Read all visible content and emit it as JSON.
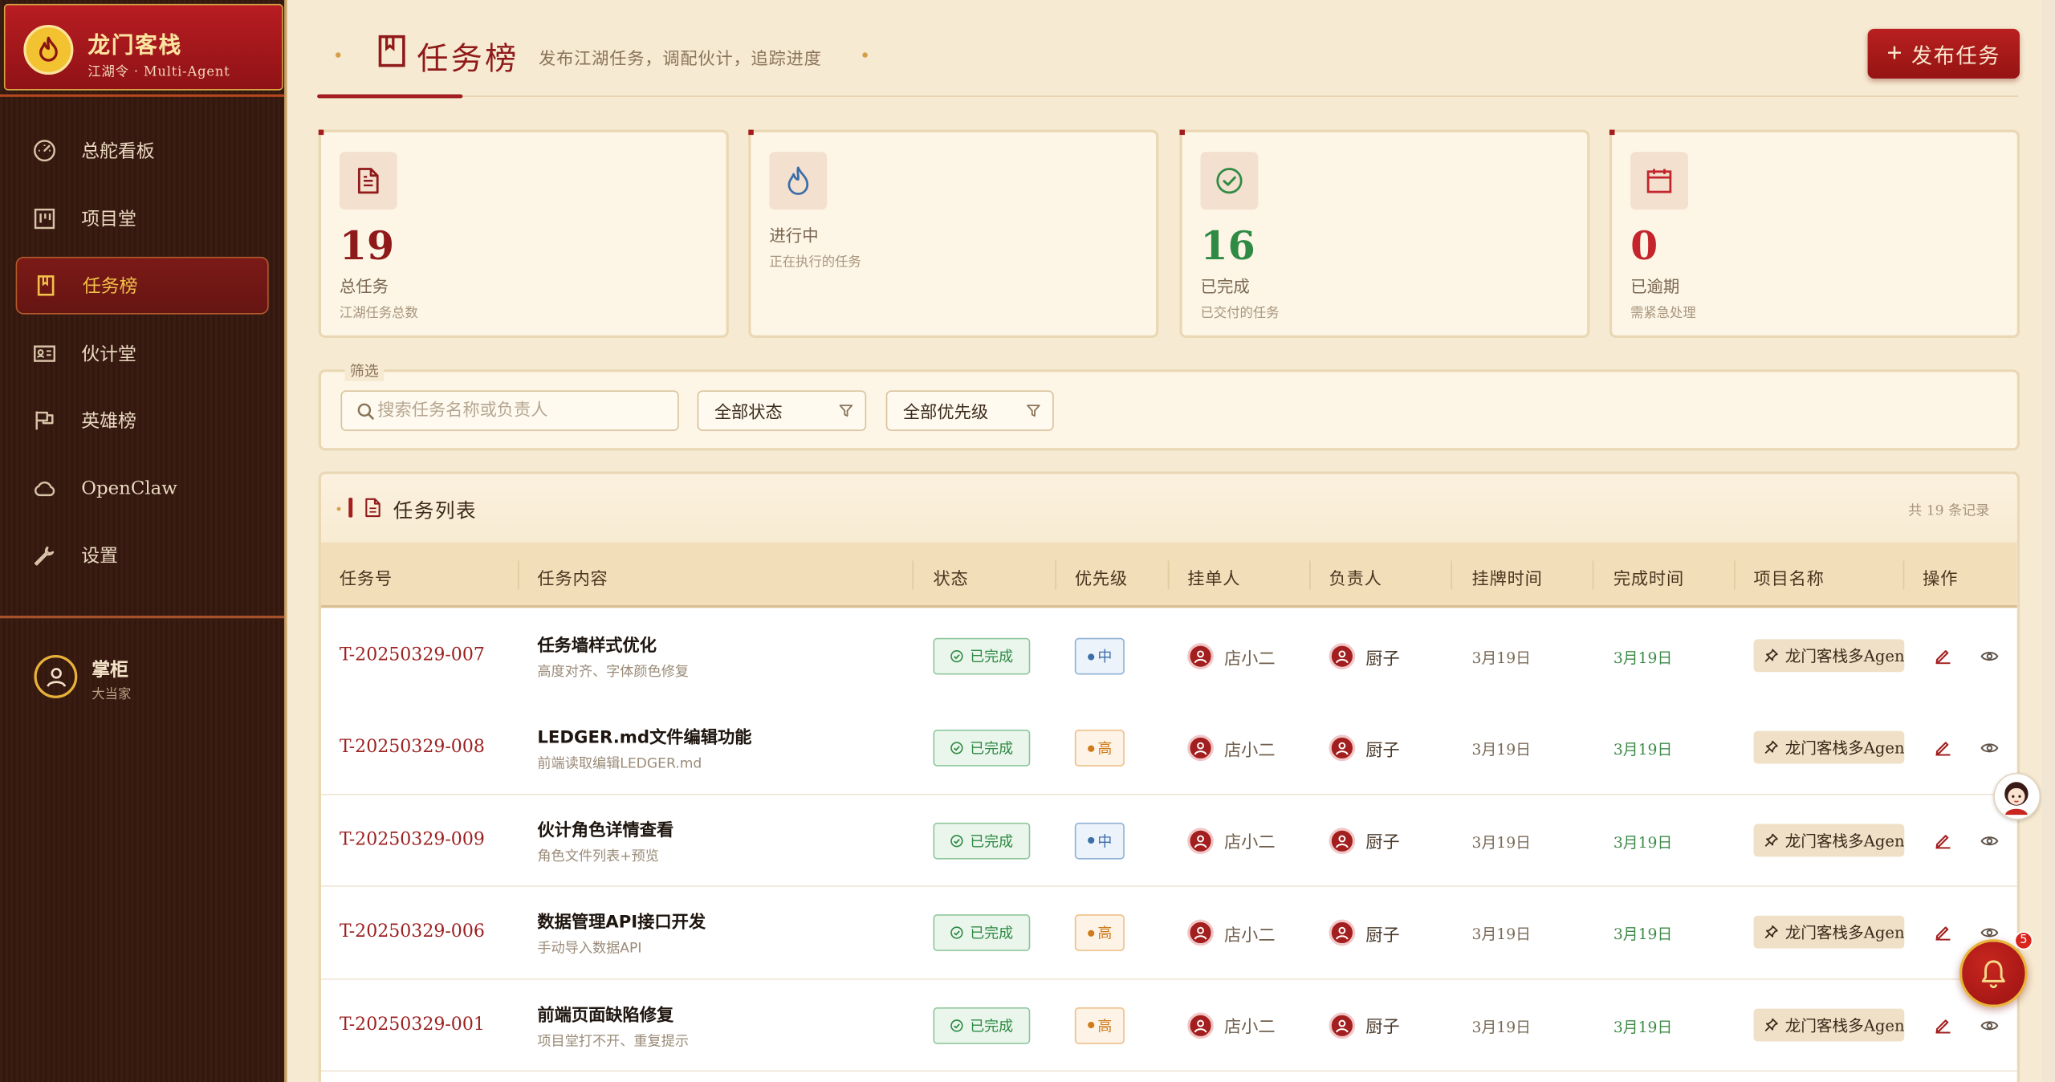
{
  "brand": {
    "title": "龙门客栈",
    "subtitle": "江湖令 · Multi-Agent"
  },
  "nav": [
    {
      "label": "总舵看板",
      "icon": "dashboard-icon",
      "active": false
    },
    {
      "label": "项目堂",
      "icon": "board-icon",
      "active": false
    },
    {
      "label": "任务榜",
      "icon": "bookmark-icon",
      "active": true
    },
    {
      "label": "伙计堂",
      "icon": "id-card-icon",
      "active": false
    },
    {
      "label": "英雄榜",
      "icon": "flag-icon",
      "active": false
    },
    {
      "label": "OpenClaw",
      "icon": "cloud-icon",
      "active": false
    },
    {
      "label": "设置",
      "icon": "wrench-icon",
      "active": false
    }
  ],
  "user": {
    "name": "掌柜",
    "role": "大当家"
  },
  "header": {
    "title": "任务榜",
    "subtitle": "发布江湖任务，调配伙计，追踪进度",
    "publish_label": "发布任务",
    "publish_plus": "+"
  },
  "stats": [
    {
      "value": "19",
      "label": "总任务",
      "desc": "江湖任务总数",
      "color": "#8f1a1a",
      "icon": "document-icon"
    },
    {
      "value": "",
      "label": "进行中",
      "desc": "正在执行的任务",
      "color": "#3c6ea8",
      "icon": "flame-icon"
    },
    {
      "value": "16",
      "label": "已完成",
      "desc": "已交付的任务",
      "color": "#2f8a44",
      "icon": "check-circle-icon"
    },
    {
      "value": "0",
      "label": "已逾期",
      "desc": "需紧急处理",
      "color": "#c4242b",
      "icon": "calendar-icon"
    }
  ],
  "filter": {
    "legend": "筛选",
    "search_placeholder": "搜索任务名称或负责人",
    "status_value": "全部状态",
    "priority_value": "全部优先级"
  },
  "table": {
    "title": "任务列表",
    "count_text": "共 19 条记录",
    "columns": [
      "任务号",
      "任务内容",
      "状态",
      "优先级",
      "挂单人",
      "负责人",
      "挂牌时间",
      "完成时间",
      "项目名称",
      "操作"
    ],
    "rows": [
      {
        "id": "T-20250329-007",
        "title": "任务墙样式优化",
        "desc": "高度对齐、字体颜色修复",
        "status": "已完成",
        "priority": "中",
        "priority_level": "mid",
        "poster": "店小二",
        "owner": "厨子",
        "posted": "3月19日",
        "done": "3月19日",
        "project": "龙门客栈多Agen"
      },
      {
        "id": "T-20250329-008",
        "title": "LEDGER.md文件编辑功能",
        "desc": "前端读取编辑LEDGER.md",
        "status": "已完成",
        "priority": "高",
        "priority_level": "high",
        "poster": "店小二",
        "owner": "厨子",
        "posted": "3月19日",
        "done": "3月19日",
        "project": "龙门客栈多Agen"
      },
      {
        "id": "T-20250329-009",
        "title": "伙计角色详情查看",
        "desc": "角色文件列表+预览",
        "status": "已完成",
        "priority": "中",
        "priority_level": "mid",
        "poster": "店小二",
        "owner": "厨子",
        "posted": "3月19日",
        "done": "3月19日",
        "project": "龙门客栈多Agen"
      },
      {
        "id": "T-20250329-006",
        "title": "数据管理API接口开发",
        "desc": "手动导入数据API",
        "status": "已完成",
        "priority": "高",
        "priority_level": "high",
        "poster": "店小二",
        "owner": "厨子",
        "posted": "3月19日",
        "done": "3月19日",
        "project": "龙门客栈多Agen"
      },
      {
        "id": "T-20250329-001",
        "title": "前端页面缺陷修复",
        "desc": "项目堂打不开、重复提示",
        "status": "已完成",
        "priority": "高",
        "priority_level": "high",
        "poster": "店小二",
        "owner": "厨子",
        "posted": "3月19日",
        "done": "3月19日",
        "project": "龙门客栈多Agen"
      }
    ]
  },
  "notifications": {
    "count": "5"
  },
  "colors": {
    "accent": "#a31e1e",
    "gold": "#e7b53c",
    "success": "#2f8a44",
    "warning": "#d07b1b",
    "info": "#3c6ea8"
  }
}
